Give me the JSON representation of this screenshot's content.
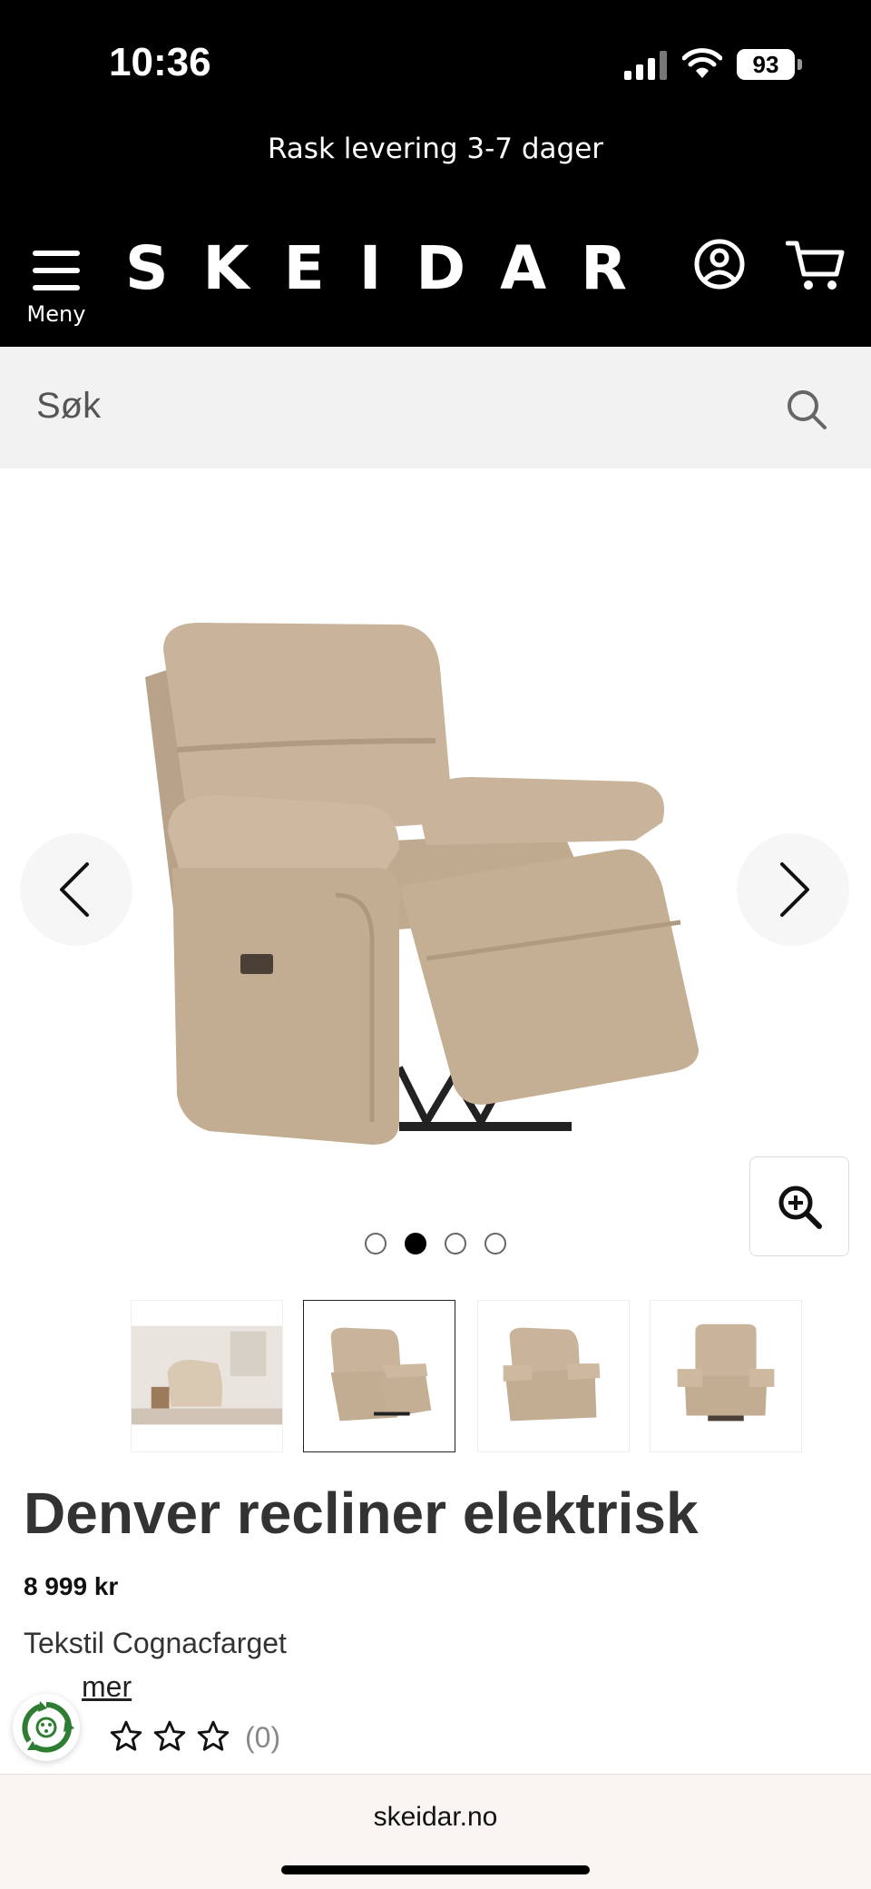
{
  "status_bar": {
    "time": "10:36",
    "battery": "93",
    "icons": [
      "signal-icon",
      "wifi-icon",
      "battery-icon"
    ]
  },
  "promo": {
    "text": "Rask levering 3-7 dager"
  },
  "header": {
    "menu_label": "Meny",
    "logo": "SKEIDAR",
    "icons": [
      "menu-icon",
      "account-icon",
      "cart-icon"
    ]
  },
  "search": {
    "placeholder": "Søk",
    "icon": "search-icon"
  },
  "gallery": {
    "slide_count": 4,
    "active_slide": 2,
    "controls": [
      "chevron-left-icon",
      "chevron-right-icon",
      "zoom-in-icon"
    ],
    "thumbnails": [
      "room-scene",
      "recliner-reclined",
      "recliner-angle",
      "recliner-front"
    ],
    "selected_thumbnail": 2
  },
  "product": {
    "title": "Denver recliner elektrisk",
    "price": "8 999 kr",
    "variant": "Tekstil Cognacfarget",
    "read_more": "mer",
    "rating_stars": 0,
    "review_count": "(0)"
  },
  "browser": {
    "url": "skeidar.no"
  },
  "colors": {
    "header_bg": "#000000",
    "search_bg": "#f2f2f2",
    "upholstery": "#c9b49b",
    "eco_green": "#2e7d32"
  }
}
